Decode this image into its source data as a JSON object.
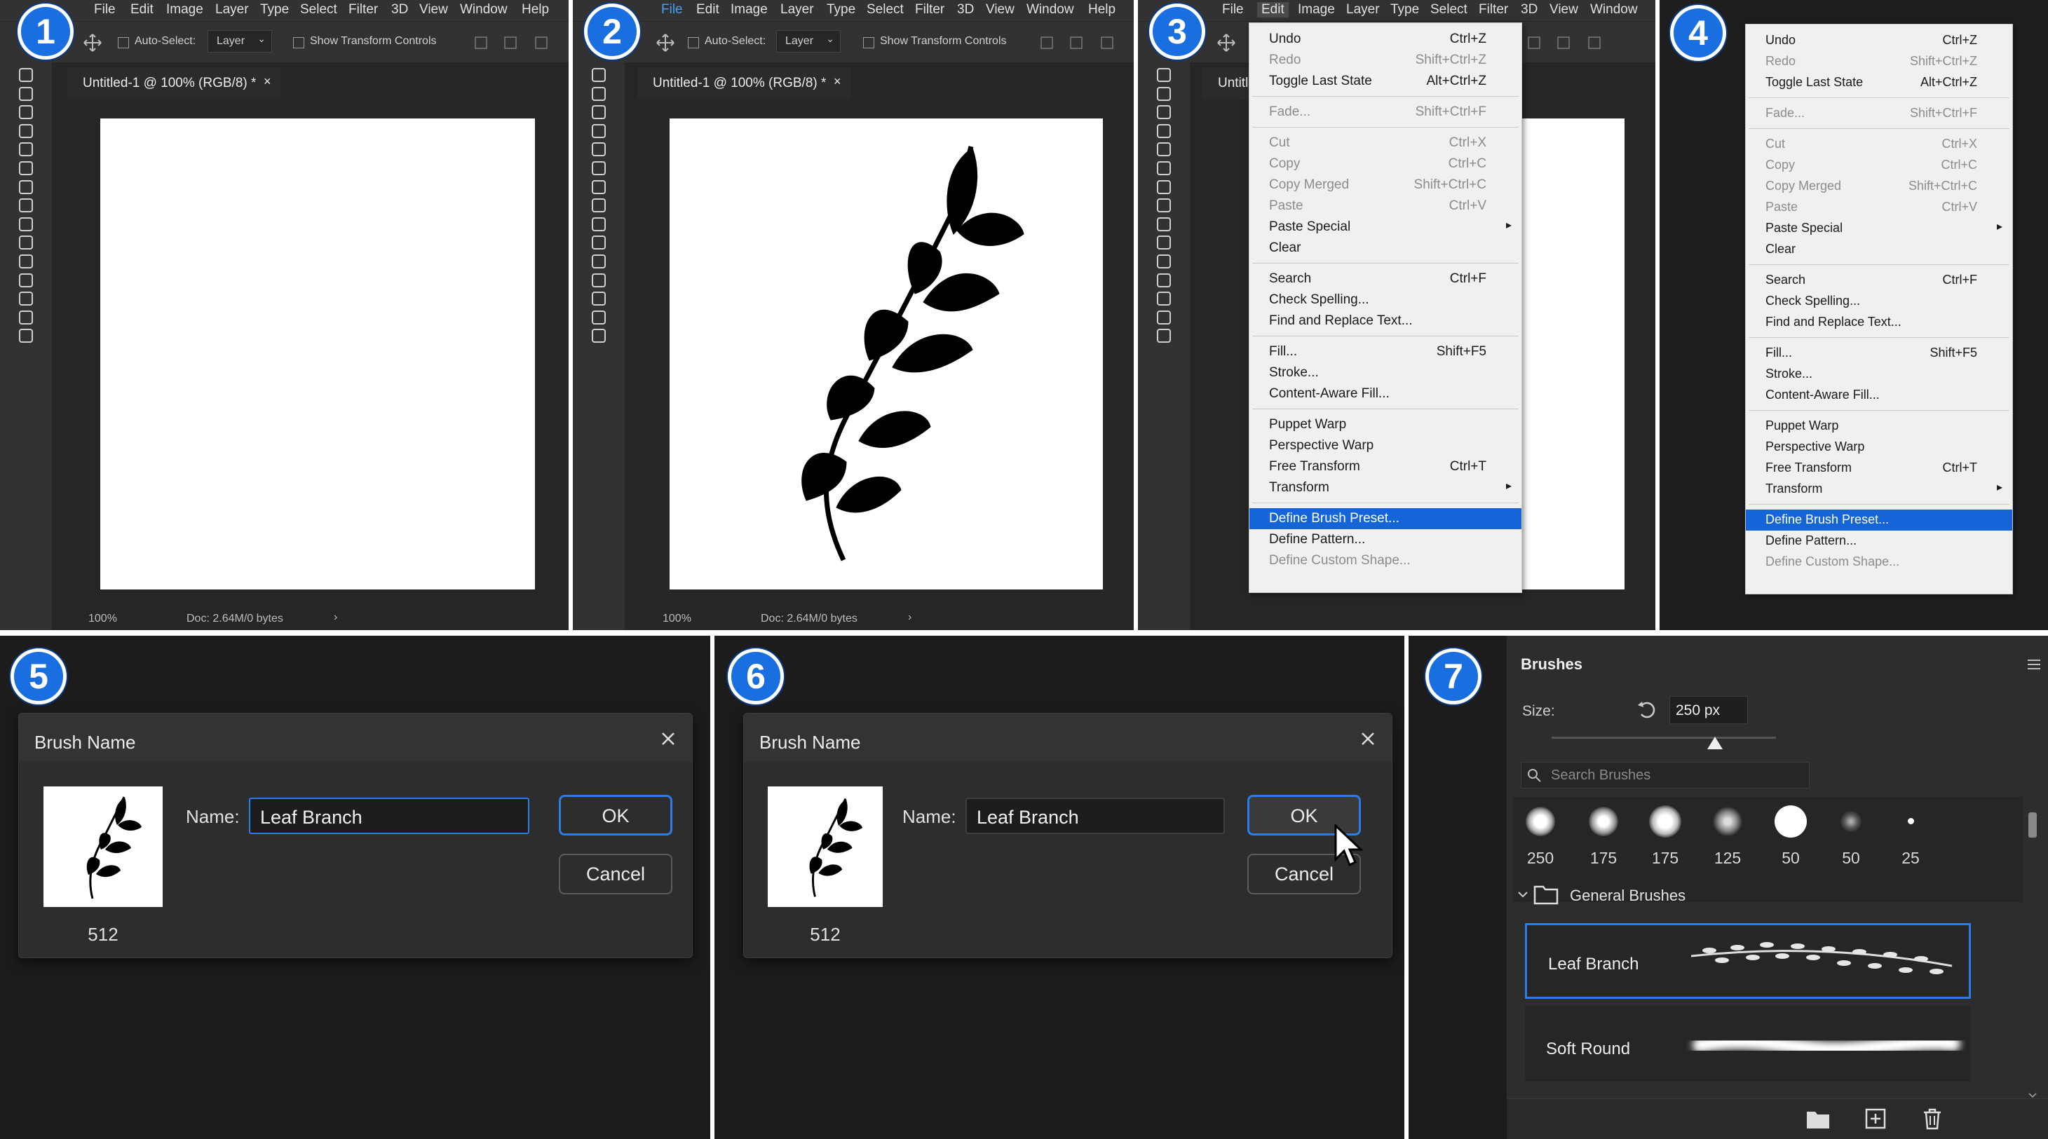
{
  "steps": [
    "1",
    "2",
    "3",
    "4",
    "5",
    "6",
    "7"
  ],
  "menubar": {
    "items": [
      "File",
      "Edit",
      "Image",
      "Layer",
      "Type",
      "Select",
      "Filter",
      "3D",
      "View",
      "Window",
      "Help"
    ]
  },
  "optionsbar": {
    "auto_select": "Auto-Select:",
    "layer_select": "Layer",
    "show_transform": "Show Transform Controls"
  },
  "document": {
    "tab_title": "Untitled-1 @ 100% (RGB/8) *",
    "tab_title_short": "Untitl",
    "zoom": "100%",
    "doc_size": "Doc: 2.64M/0 bytes"
  },
  "edit_menu": {
    "items": [
      {
        "label": "Undo",
        "shortcut": "Ctrl+Z",
        "disabled": false
      },
      {
        "label": "Redo",
        "shortcut": "Shift+Ctrl+Z",
        "disabled": true
      },
      {
        "label": "Toggle Last State",
        "shortcut": "Alt+Ctrl+Z",
        "disabled": false
      },
      {
        "label": "Fade...",
        "shortcut": "Shift+Ctrl+F",
        "disabled": true
      },
      {
        "label": "Cut",
        "shortcut": "Ctrl+X",
        "disabled": true
      },
      {
        "label": "Copy",
        "shortcut": "Ctrl+C",
        "disabled": true
      },
      {
        "label": "Copy Merged",
        "shortcut": "Shift+Ctrl+C",
        "disabled": true
      },
      {
        "label": "Paste",
        "shortcut": "Ctrl+V",
        "disabled": true
      },
      {
        "label": "Paste Special",
        "shortcut": "",
        "disabled": false,
        "submenu": true
      },
      {
        "label": "Clear",
        "shortcut": "",
        "disabled": false
      },
      {
        "label": "Search",
        "shortcut": "Ctrl+F",
        "disabled": false
      },
      {
        "label": "Check Spelling...",
        "shortcut": "",
        "disabled": false
      },
      {
        "label": "Find and Replace Text...",
        "shortcut": "",
        "disabled": false
      },
      {
        "label": "Fill...",
        "shortcut": "Shift+F5",
        "disabled": false
      },
      {
        "label": "Stroke...",
        "shortcut": "",
        "disabled": false
      },
      {
        "label": "Content-Aware Fill...",
        "shortcut": "",
        "disabled": false
      },
      {
        "label": "Puppet Warp",
        "shortcut": "",
        "disabled": false
      },
      {
        "label": "Perspective Warp",
        "shortcut": "",
        "disabled": false
      },
      {
        "label": "Free Transform",
        "shortcut": "Ctrl+T",
        "disabled": false
      },
      {
        "label": "Transform",
        "shortcut": "",
        "disabled": false,
        "submenu": true
      },
      {
        "label": "Define Brush Preset...",
        "shortcut": "",
        "disabled": false,
        "highlighted": true
      },
      {
        "label": "Define Pattern...",
        "shortcut": "",
        "disabled": false
      },
      {
        "label": "Define Custom Shape...",
        "shortcut": "",
        "disabled": true
      }
    ]
  },
  "brush_dialog": {
    "title": "Brush Name",
    "name_label": "Name:",
    "name_value": "Leaf Branch",
    "thumb_size": "512",
    "ok_label": "OK",
    "cancel_label": "Cancel"
  },
  "brushes_panel": {
    "title": "Brushes",
    "size_label": "Size:",
    "size_value": "250 px",
    "search_placeholder": "Search Brushes",
    "tips": [
      "250",
      "175",
      "175",
      "125",
      "50",
      "50",
      "25"
    ],
    "group_name": "General Brushes",
    "brushes": [
      {
        "name": "Leaf Branch",
        "selected": true
      },
      {
        "name": "Soft Round",
        "selected": false
      }
    ]
  },
  "colors": {
    "accent": "#1a6fe0",
    "highlight": "#1565d8",
    "focus": "#2a7de8"
  }
}
